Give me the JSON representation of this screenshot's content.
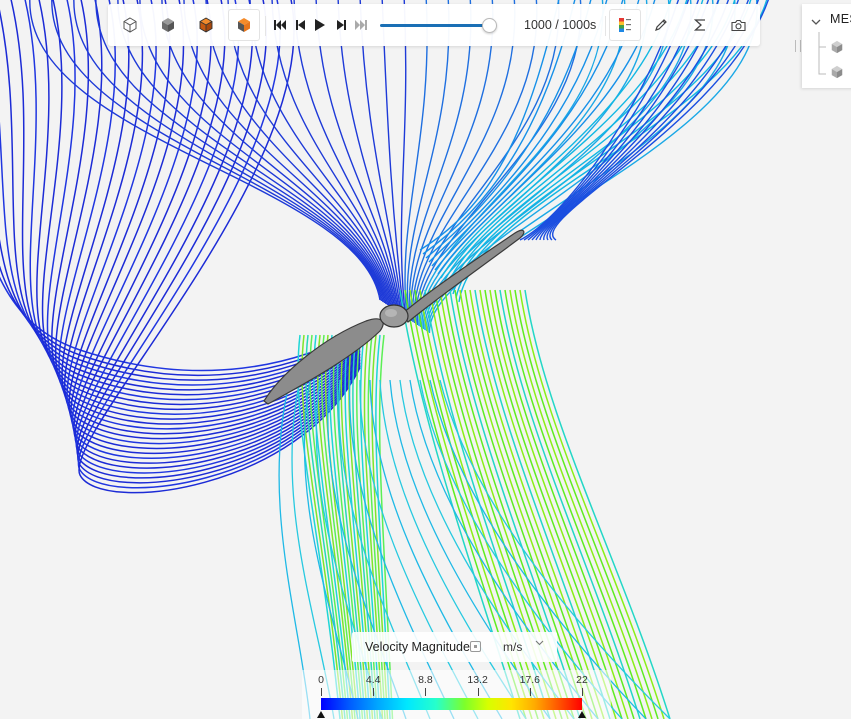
{
  "toolbar": {
    "view_buttons": [
      {
        "icon": "wireframe-cube-icon",
        "active": false
      },
      {
        "icon": "solid-cube-icon",
        "active": false
      },
      {
        "icon": "orange-edge-cube-icon",
        "active": false
      },
      {
        "icon": "orange-face-cube-icon",
        "active": true
      }
    ],
    "playback": [
      "skip-to-start-icon",
      "step-back-icon",
      "play-icon",
      "step-forward-icon",
      "skip-to-end-icon"
    ],
    "timeline_progress": 1.0,
    "frame_readout": "1000 / 1000s",
    "tools": [
      "color-legend-icon",
      "probe-pen-icon",
      "sigma-icon",
      "camera-icon"
    ]
  },
  "tree_panel": {
    "title": "MES",
    "toggle_icon": "chevron-down-icon",
    "items": [
      {
        "icon": "mesh-cube-icon"
      },
      {
        "icon": "mesh-cube-icon"
      }
    ]
  },
  "legend": {
    "title": "Velocity Magnitude",
    "unit": "m/s",
    "ticks": [
      "0",
      "4.4",
      "8.8",
      "13.2",
      "17.6",
      "22"
    ],
    "min": 0,
    "max": 22
  },
  "colors": {
    "accent": "#1a6fb5",
    "low": "#0000ff",
    "high": "#ff0000",
    "propeller": "#8c8c8c"
  }
}
